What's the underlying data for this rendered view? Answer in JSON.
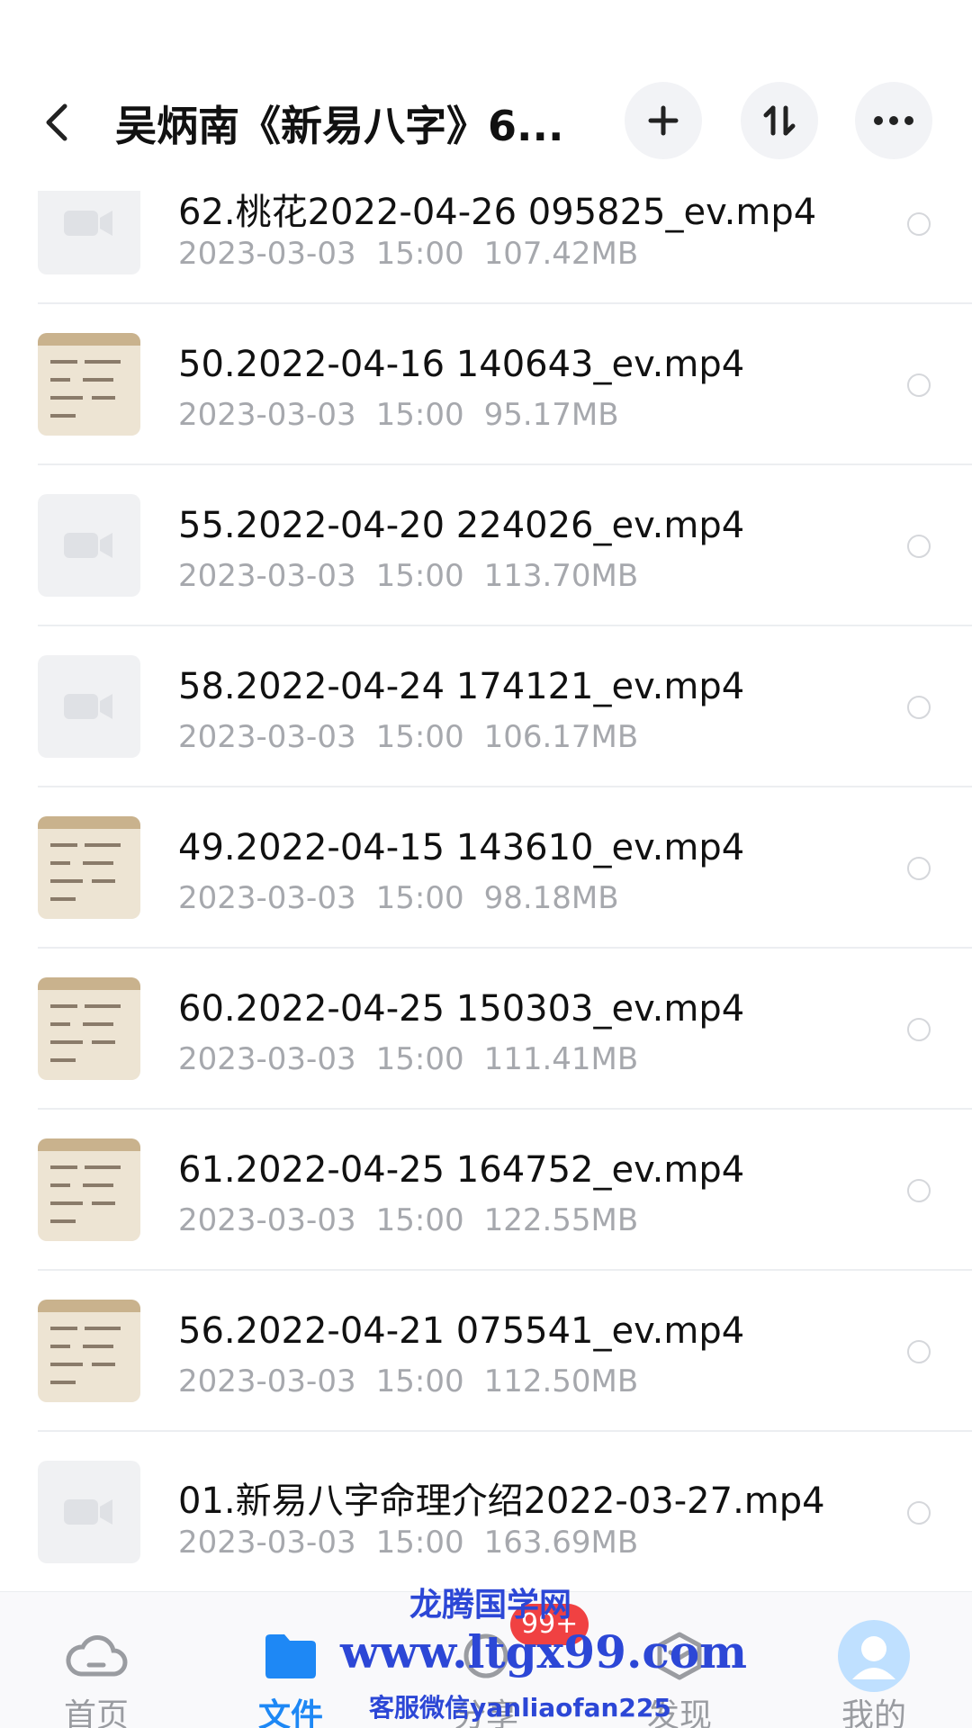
{
  "header": {
    "title": "吴炳南《新易八字》6..."
  },
  "files": [
    {
      "name": "62.桃花2022-04-26 095825_ev.mp4",
      "date": "2023-03-03",
      "time": "15:00",
      "size": "107.42MB",
      "thumb": "video-placeholder"
    },
    {
      "name": "50.2022-04-16 140643_ev.mp4",
      "date": "2023-03-03",
      "time": "15:00",
      "size": "95.17MB",
      "thumb": "whiteboard-frame"
    },
    {
      "name": "55.2022-04-20 224026_ev.mp4",
      "date": "2023-03-03",
      "time": "15:00",
      "size": "113.70MB",
      "thumb": "video-placeholder"
    },
    {
      "name": "58.2022-04-24 174121_ev.mp4",
      "date": "2023-03-03",
      "time": "15:00",
      "size": "106.17MB",
      "thumb": "video-placeholder"
    },
    {
      "name": "49.2022-04-15 143610_ev.mp4",
      "date": "2023-03-03",
      "time": "15:00",
      "size": "98.18MB",
      "thumb": "whiteboard-frame"
    },
    {
      "name": "60.2022-04-25 150303_ev.mp4",
      "date": "2023-03-03",
      "time": "15:00",
      "size": "111.41MB",
      "thumb": "whiteboard-frame"
    },
    {
      "name": "61.2022-04-25 164752_ev.mp4",
      "date": "2023-03-03",
      "time": "15:00",
      "size": "122.55MB",
      "thumb": "whiteboard-frame"
    },
    {
      "name": "56.2022-04-21 075541_ev.mp4",
      "date": "2023-03-03",
      "time": "15:00",
      "size": "112.50MB",
      "thumb": "whiteboard-frame"
    },
    {
      "name": "01.新易八字命理介绍2022-03-27.mp4",
      "date": "2023-03-03",
      "time": "15:00",
      "size": "163.69MB",
      "thumb": "video-placeholder"
    }
  ],
  "nav": {
    "home": "首页",
    "files": "文件",
    "share": "分享",
    "discover": "发现",
    "me": "我的",
    "badge": "99+",
    "active": "files"
  },
  "watermark": {
    "line1": "龙腾国学网",
    "line2": "www.ltgx99.com",
    "line3": "客服微信yanliaofan225"
  },
  "colors": {
    "accent": "#1e88f5",
    "badge": "#f04142",
    "watermark": "#2c47d6"
  }
}
